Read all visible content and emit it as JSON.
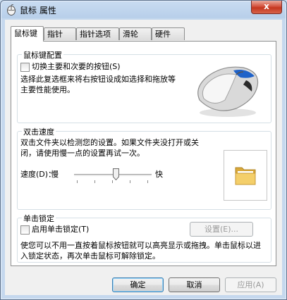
{
  "window": {
    "title": "鼠标 属性",
    "close_label": "x"
  },
  "tabs": [
    {
      "label": "鼠标键",
      "active": true
    },
    {
      "label": "指针",
      "active": false
    },
    {
      "label": "指针选项",
      "active": false
    },
    {
      "label": "滑轮",
      "active": false
    },
    {
      "label": "硬件",
      "active": false
    }
  ],
  "button_config": {
    "title": "鼠标键配置",
    "switch_checkbox_label": "切换主要和次要的按钮(S)",
    "switch_checked": false,
    "description": "选择此复选框来将右按钮设成如选择和拖放等主要性能使用。"
  },
  "double_click": {
    "title": "双击速度",
    "description": "双击文件夹以检测您的设置。如果文件夹没打开或关闭，请使用慢一点的设置再试一次。",
    "speed_label": "速度(D)：",
    "slow_label": "慢",
    "fast_label": "快",
    "slider_value": 0.54
  },
  "click_lock": {
    "title": "单击锁定",
    "checkbox_label": "启用单击锁定(T)",
    "checked": false,
    "settings_button": "设置(E)...",
    "description": "使您可以不用一直按着鼠标按钮就可以高亮显示或拖拽。单击鼠标以进入锁定状态，再次单击鼠标可解除锁定。"
  },
  "footer": {
    "ok": "确定",
    "cancel": "取消",
    "apply": "应用(A)"
  },
  "colors": {
    "title_bar": "#c9dcf1",
    "panel": "#ffffff",
    "accent": "#3c7fb1",
    "close": "#c4361f"
  }
}
